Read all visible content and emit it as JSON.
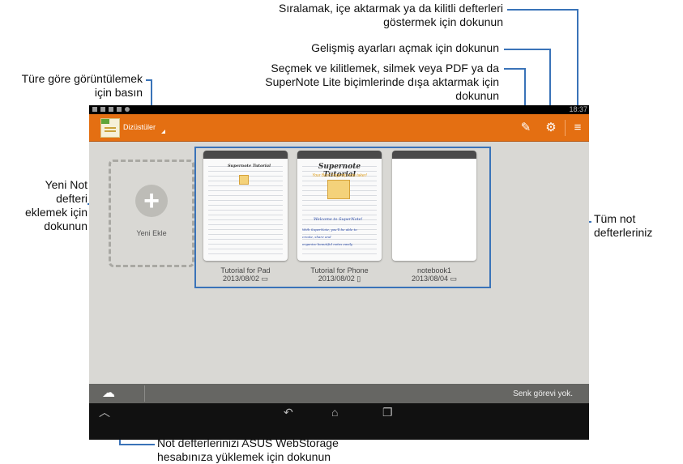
{
  "callouts": {
    "sort_import": [
      "Sıralamak, içe aktarmak ya da kilitli defterleri",
      "göstermek için dokunun"
    ],
    "advanced_settings": "Gelişmiş ayarları açmak için dokunun",
    "select_lock": [
      "Seçmek ve kilitlemek, silmek veya PDF ya da",
      "SuperNote Lite biçimlerinde dışa aktarmak için",
      "dokunun"
    ],
    "view_by_type": [
      "Türe göre görüntülemek",
      "için basın"
    ],
    "add_notebook": [
      "Yeni Not",
      "defteri",
      "eklemek için",
      "dokunun"
    ],
    "all_notebooks": [
      "Tüm not",
      "defterleriniz"
    ],
    "webstorage": [
      "Not defterlerinizi ASUS WebStorage",
      "hesabınıza yüklemek için dokunun"
    ]
  },
  "status_bar": {
    "time": "18:37"
  },
  "action_bar": {
    "view_label": "Dizüstüler",
    "icons": [
      "notebook-icon",
      "select-edit-icon",
      "gear-icon",
      "menu-icon"
    ]
  },
  "add_new": {
    "label": "Yeni Ekle",
    "icon": "plus-icon"
  },
  "notebooks": [
    {
      "name": "Tutorial for Pad",
      "date": "2013/08/02",
      "device_icon": "▭",
      "cover_title": "Supernote Tutorial"
    },
    {
      "name": "Tutorial for Phone",
      "date": "2013/08/02",
      "device_icon": "▯",
      "cover_title": "Supernote Tutorial",
      "cover_subtitle": "Your Best Fingertip note taker!",
      "handwriting": [
        "Welcome to SuperNote!",
        "With SuperNote, you'll be able to",
        "create, share and",
        "organize beautiful notes easily"
      ]
    },
    {
      "name": "notebook1",
      "date": "2013/08/04",
      "device_icon": "▭"
    }
  ],
  "bottom_bar": {
    "sync_status": "Senk görevi yok.",
    "cloud_icon": "cloud-sync-icon"
  },
  "nav_bar": {
    "icons": [
      "up-arrow-icon",
      "back-icon",
      "home-icon",
      "recent-apps-icon"
    ]
  },
  "colors": {
    "action_bar": "#e46f12",
    "background": "#d9d8d4",
    "callout_line": "#3a73b8"
  }
}
